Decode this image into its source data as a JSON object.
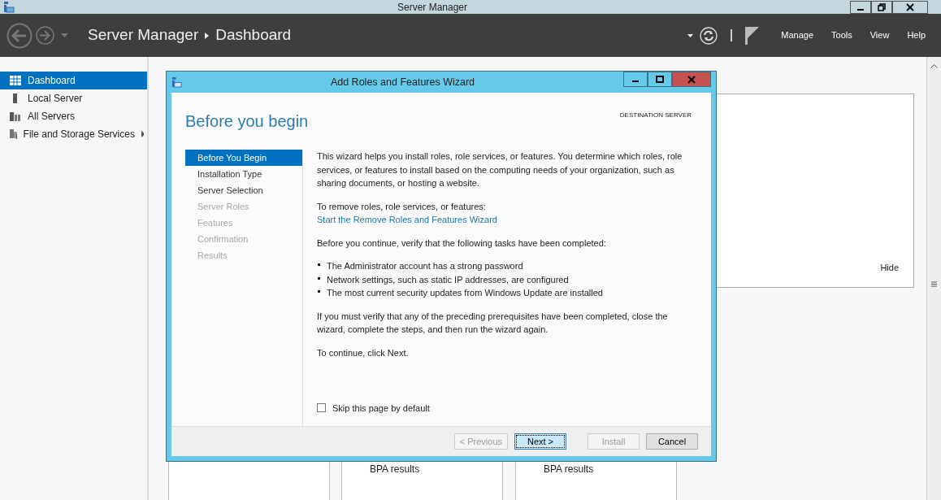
{
  "window": {
    "title": "Server Manager"
  },
  "header": {
    "breadcrumb": [
      "Server Manager",
      "Dashboard"
    ],
    "menu": [
      "Manage",
      "Tools",
      "View",
      "Help"
    ]
  },
  "sidebar": {
    "items": [
      {
        "label": "Dashboard",
        "selected": true,
        "kind": "dashboard"
      },
      {
        "label": "Local Server",
        "selected": false,
        "kind": "server"
      },
      {
        "label": "All Servers",
        "selected": false,
        "kind": "servers"
      },
      {
        "label": "File and Storage Services",
        "selected": false,
        "kind": "storage",
        "expandable": true
      }
    ]
  },
  "dashboard": {
    "panel_link": "Hide",
    "tiles": [
      {
        "label": "BPA results"
      },
      {
        "label": "BPA results"
      }
    ]
  },
  "wizard": {
    "title": "Add Roles and Features Wizard",
    "heading": "Before you begin",
    "destination_label": "DESTINATION SERVER",
    "steps": [
      {
        "label": "Before You Begin",
        "selected": true,
        "disabled": false
      },
      {
        "label": "Installation Type",
        "selected": false,
        "disabled": false
      },
      {
        "label": "Server Selection",
        "selected": false,
        "disabled": false
      },
      {
        "label": "Server Roles",
        "selected": false,
        "disabled": true
      },
      {
        "label": "Features",
        "selected": false,
        "disabled": true
      },
      {
        "label": "Confirmation",
        "selected": false,
        "disabled": true
      },
      {
        "label": "Results",
        "selected": false,
        "disabled": true
      }
    ],
    "content": [
      {
        "kind": "paragraph",
        "text": "This wizard helps you install roles, role services, or features. You determine which roles, role services, or features to install based on the computing needs of your organization, such as sharing documents, or hosting a website."
      },
      {
        "kind": "label",
        "text": "To remove roles, role services, or features:"
      },
      {
        "kind": "link",
        "text": "Start the Remove Roles and Features Wizard"
      },
      {
        "kind": "paragraph",
        "text": "Before you continue, verify that the following tasks have been completed:"
      },
      {
        "kind": "bullets",
        "items": [
          "The Administrator account has a strong password",
          "Network settings, such as static IP addresses, are configured",
          "The most current security updates from Windows Update are installed"
        ]
      },
      {
        "kind": "paragraph",
        "text": "If you must verify that any of the preceding prerequisites have been completed, close the wizard, complete the steps, and then run the wizard again."
      },
      {
        "kind": "paragraph",
        "text": "To continue, click Next."
      }
    ],
    "skip_checkbox": {
      "label": "Skip this page by default",
      "checked": false
    },
    "buttons": [
      {
        "label": "< Previous",
        "disabled": true,
        "default": false
      },
      {
        "label": "Next >",
        "disabled": false,
        "default": true
      },
      {
        "label": "Install",
        "disabled": true,
        "default": false
      },
      {
        "label": "Cancel",
        "disabled": false,
        "default": false
      }
    ]
  }
}
